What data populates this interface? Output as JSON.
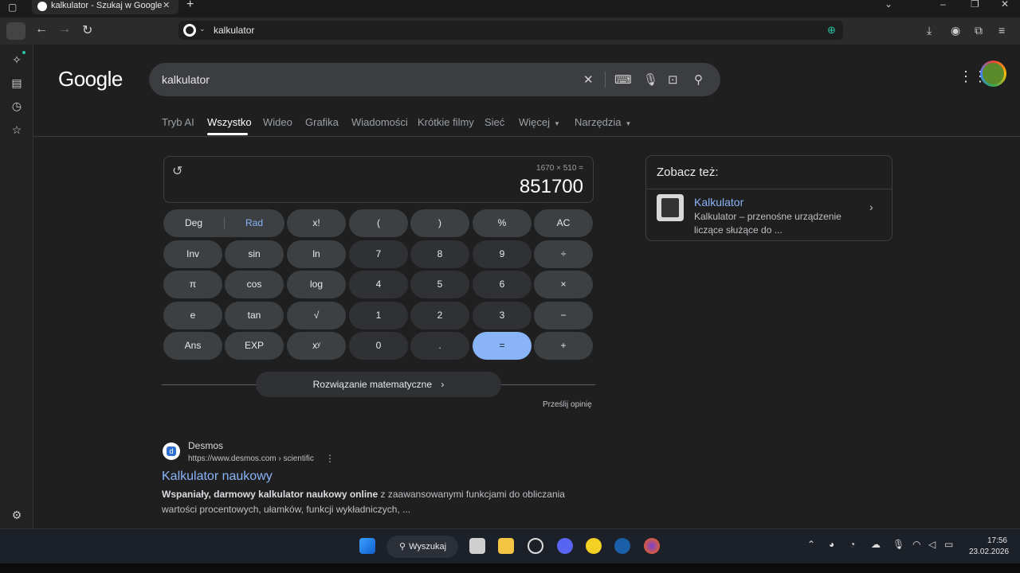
{
  "browser": {
    "tab_title": "kalkulator - Szukaj w Google",
    "tab_close": "✕",
    "new_tab": "+",
    "address": "kalkulator"
  },
  "google": {
    "logo": "Google",
    "query": "kalkulator",
    "tabs": [
      "Tryb AI",
      "Wszystko",
      "Wideo",
      "Grafika",
      "Wiadomości",
      "Krótkie filmy",
      "Sieć",
      "Więcej",
      "Narzędzia"
    ],
    "active_tab": "Wszystko"
  },
  "calculator": {
    "expression": "1670 × 510 =",
    "result": "851700",
    "mode_deg": "Deg",
    "mode_rad": "Rad",
    "keys": {
      "fact": "x!",
      "lparen": "(",
      "rparen": ")",
      "percent": "%",
      "ac": "AC",
      "inv": "Inv",
      "sin": "sin",
      "ln": "ln",
      "k7": "7",
      "k8": "8",
      "k9": "9",
      "div": "÷",
      "pi": "π",
      "cos": "cos",
      "log": "log",
      "k4": "4",
      "k5": "5",
      "k6": "6",
      "mul": "×",
      "e": "e",
      "tan": "tan",
      "sqrt": "√",
      "k1": "1",
      "k2": "2",
      "k3": "3",
      "sub": "−",
      "ans": "Ans",
      "exp": "EXP",
      "pow": "xʸ",
      "k0": "0",
      "dot": ".",
      "eq": "=",
      "add": "+"
    },
    "solve_label": "Rozwiązanie matematyczne",
    "feedback": "Prześlij opinię"
  },
  "result": {
    "site": "Desmos",
    "url": "https://www.desmos.com › scientific",
    "title": "Kalkulator naukowy",
    "snippet_bold": "Wspaniały, darmowy kalkulator naukowy online",
    "snippet_rest": " z zaawansowanymi funkcjami do obliczania wartości procentowych, ułamków, funkcji wykładniczych, ..."
  },
  "see_also": {
    "title": "Zobacz też:",
    "item_name": "Kalkulator",
    "item_desc": "Kalkulator – przenośne urządzenie liczące służące do ..."
  },
  "taskbar": {
    "search_label": "Wyszukaj",
    "time": "17:56",
    "date": "23.02.2026"
  }
}
